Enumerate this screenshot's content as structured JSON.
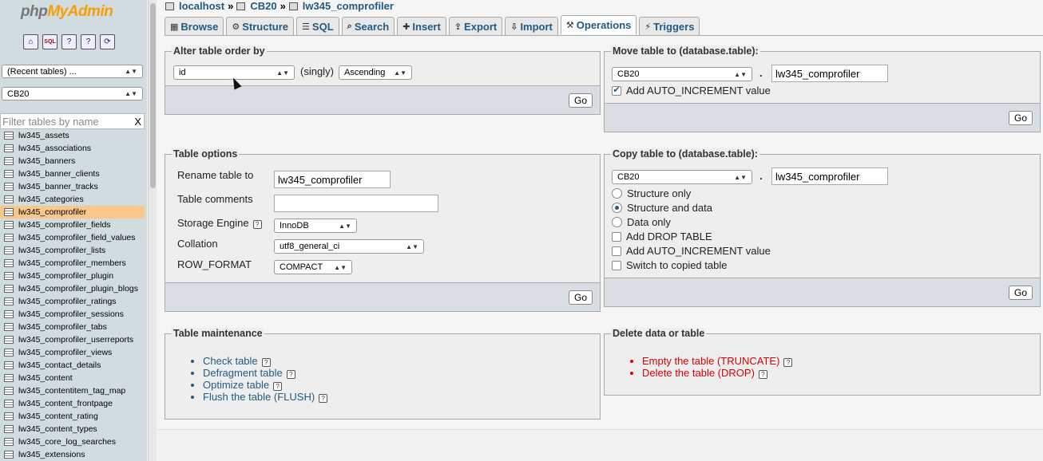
{
  "sidebar": {
    "logo": {
      "php": "php",
      "my": "My",
      "admin": "Admin"
    },
    "icons": [
      "home-icon",
      "sql-query-icon",
      "docs-icon",
      "help-icon",
      "reload-icon"
    ],
    "icon_glyphs": [
      "⌂",
      "SQL",
      "?",
      "?",
      "⟳"
    ],
    "recent_tables": "(Recent tables) ...",
    "database": "CB20",
    "filter_placeholder": "Filter tables by name",
    "filter_clear": "X",
    "tables": [
      "lw345_assets",
      "lw345_associations",
      "lw345_banners",
      "lw345_banner_clients",
      "lw345_banner_tracks",
      "lw345_categories",
      "lw345_comprofiler",
      "lw345_comprofiler_fields",
      "lw345_comprofiler_field_values",
      "lw345_comprofiler_lists",
      "lw345_comprofiler_members",
      "lw345_comprofiler_plugin",
      "lw345_comprofiler_plugin_blogs",
      "lw345_comprofiler_ratings",
      "lw345_comprofiler_sessions",
      "lw345_comprofiler_tabs",
      "lw345_comprofiler_userreports",
      "lw345_comprofiler_views",
      "lw345_contact_details",
      "lw345_content",
      "lw345_contentitem_tag_map",
      "lw345_content_frontpage",
      "lw345_content_rating",
      "lw345_content_types",
      "lw345_core_log_searches",
      "lw345_extensions"
    ],
    "active_table": "lw345_comprofiler"
  },
  "breadcrumb": {
    "server": "localhost",
    "sep": "»",
    "database": "CB20",
    "table": "lw345_comprofiler"
  },
  "tabs": [
    {
      "label": "Browse",
      "icon": "▦"
    },
    {
      "label": "Structure",
      "icon": "⚙"
    },
    {
      "label": "SQL",
      "icon": "☰"
    },
    {
      "label": "Search",
      "icon": "⌕"
    },
    {
      "label": "Insert",
      "icon": "✚"
    },
    {
      "label": "Export",
      "icon": "⇪"
    },
    {
      "label": "Import",
      "icon": "⇩"
    },
    {
      "label": "Operations",
      "icon": "⚒"
    },
    {
      "label": "Triggers",
      "icon": "⚡"
    }
  ],
  "active_tab": "Operations",
  "alter_order": {
    "legend": "Alter table order by",
    "column": "id",
    "singly": "(singly)",
    "direction": "Ascending",
    "go": "Go"
  },
  "move_table": {
    "legend": "Move table to (database.table):",
    "database": "CB20",
    "dot": ".",
    "table_name": "lw345_comprofiler",
    "auto_increment_label": "Add AUTO_INCREMENT value",
    "auto_increment_checked": true,
    "go": "Go"
  },
  "table_options": {
    "legend": "Table options",
    "rename_label": "Rename table to",
    "rename_value": "lw345_comprofiler",
    "comments_label": "Table comments",
    "comments_value": "",
    "engine_label": "Storage Engine",
    "engine_value": "InnoDB",
    "collation_label": "Collation",
    "collation_value": "utf8_general_ci",
    "row_format_label": "ROW_FORMAT",
    "row_format_value": "COMPACT",
    "go": "Go"
  },
  "copy_table": {
    "legend": "Copy table to (database.table):",
    "database": "CB20",
    "dot": ".",
    "table_name": "lw345_comprofiler",
    "structure_only": "Structure only",
    "structure_and_data": "Structure and data",
    "data_only": "Data only",
    "add_drop": "Add DROP TABLE",
    "add_auto_increment": "Add AUTO_INCREMENT value",
    "switch_to_copied": "Switch to copied table",
    "selected_mode": "structure_and_data",
    "go": "Go"
  },
  "maintenance": {
    "legend": "Table maintenance",
    "links": [
      "Check table",
      "Defragment table",
      "Optimize table",
      "Flush the table (FLUSH)"
    ]
  },
  "delete": {
    "legend": "Delete data or table",
    "links": [
      "Empty the table (TRUNCATE)",
      "Delete the table (DROP)"
    ]
  },
  "colors": {
    "link": "#235a81",
    "danger": "#dd0000",
    "active_row": "#f7c88a",
    "sidebar_bg": "#d0dce0"
  }
}
